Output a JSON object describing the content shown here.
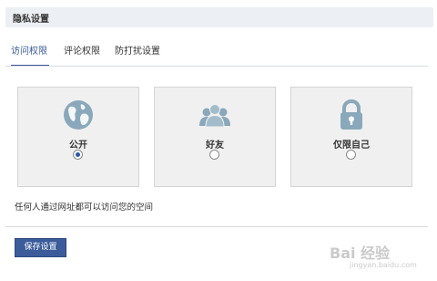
{
  "header": {
    "title": "隐私设置"
  },
  "tabs": [
    {
      "label": "访问权限",
      "active": true
    },
    {
      "label": "评论权限",
      "active": false
    },
    {
      "label": "防打扰设置",
      "active": false
    }
  ],
  "options": [
    {
      "label": "公开",
      "icon": "globe-icon",
      "selected": true
    },
    {
      "label": "好友",
      "icon": "friends-icon",
      "selected": false
    },
    {
      "label": "仅限自己",
      "icon": "lock-icon",
      "selected": false
    }
  ],
  "description": "任何人通过网址都可以访问您的空间",
  "save_button": {
    "label": "保存设置"
  },
  "watermark": {
    "text": "Bai 经验",
    "sub": "jingyan.baidu.com"
  },
  "colors": {
    "accent": "#3b5b9b",
    "icon": "#8aa8bb",
    "card_bg": "#f0f0f0"
  }
}
